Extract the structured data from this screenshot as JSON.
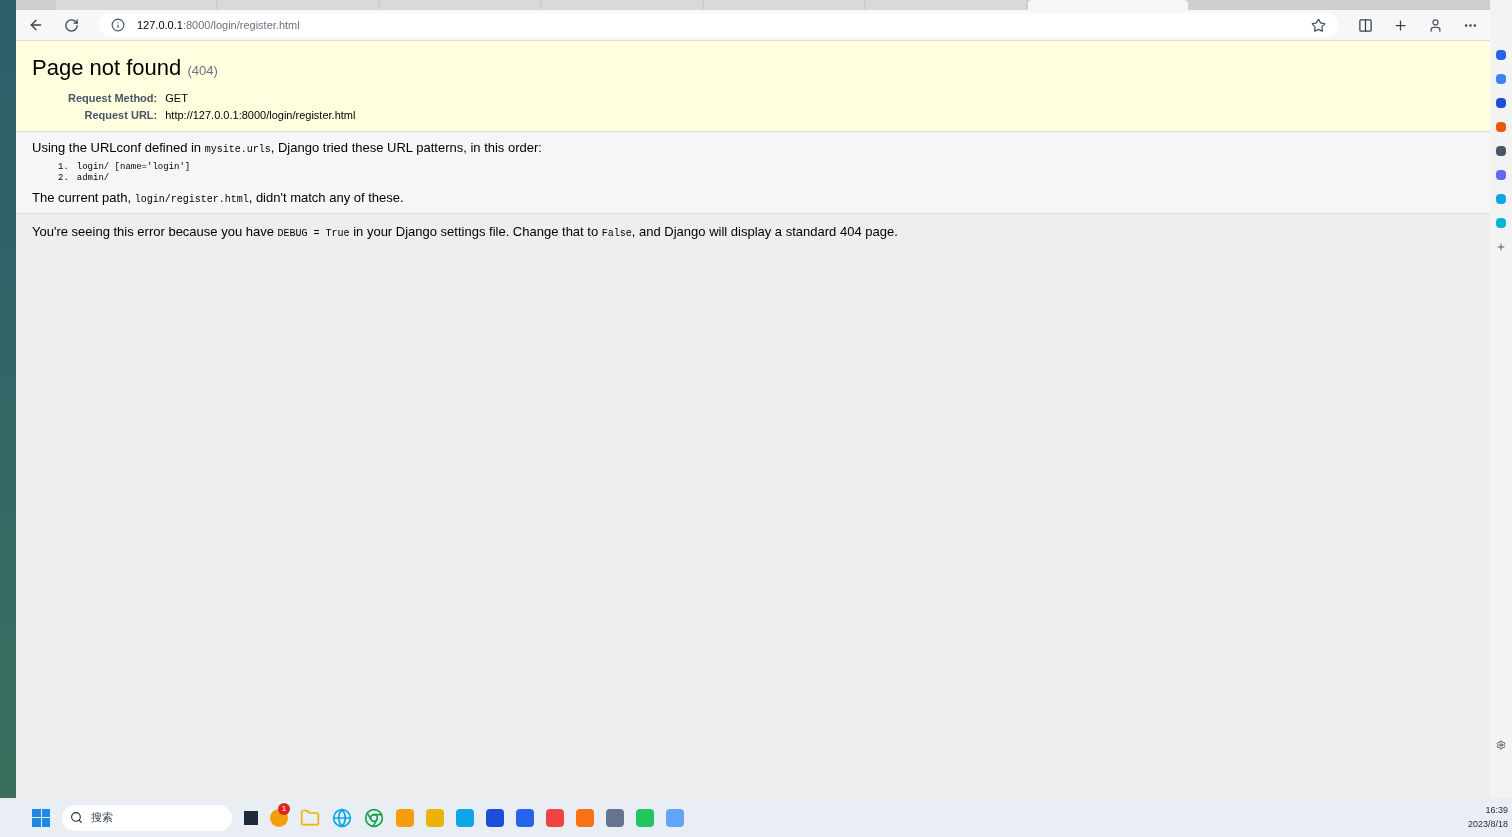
{
  "browser": {
    "tabs": [
      {
        "selected": false
      },
      {
        "selected": false
      },
      {
        "selected": false
      },
      {
        "selected": false
      },
      {
        "selected": false
      },
      {
        "selected": false
      },
      {
        "selected": true
      }
    ],
    "address": {
      "host": "127.0.0.1",
      "rest": ":8000/login/register.html"
    }
  },
  "page": {
    "title": "Page not found",
    "code": "(404)",
    "request": [
      {
        "label": "Request Method:",
        "value": "GET"
      },
      {
        "label": "Request URL:",
        "value": "http://127.0.0.1:8000/login/register.html"
      }
    ],
    "intro": [
      {
        "text": "Using the URLconf defined in ",
        "code": false
      },
      {
        "text": "mysite.urls",
        "code": true
      },
      {
        "text": ", Django tried these URL patterns, in this order:",
        "code": false
      }
    ],
    "patterns": [
      {
        "number": "1.",
        "text": "login/ [name='login']"
      },
      {
        "number": "2.",
        "text": "admin/"
      }
    ],
    "current": [
      {
        "text": "The current path, ",
        "code": false
      },
      {
        "text": "login/register.html",
        "code": true
      },
      {
        "text": ", didn't match any of these.",
        "code": false
      }
    ],
    "explanation": [
      {
        "text": "You're seeing this error because you have ",
        "code": false
      },
      {
        "text": "DEBUG = True",
        "code": true
      },
      {
        "text": " in your Django settings file. Change that to ",
        "code": false
      },
      {
        "text": "False",
        "code": true
      },
      {
        "text": ", and Django will display a standard 404 page.",
        "code": false
      }
    ]
  },
  "taskbar": {
    "search_placeholder": "搜索",
    "notification_badge": "1",
    "time": "16:39",
    "date": "2023/8/18"
  }
}
